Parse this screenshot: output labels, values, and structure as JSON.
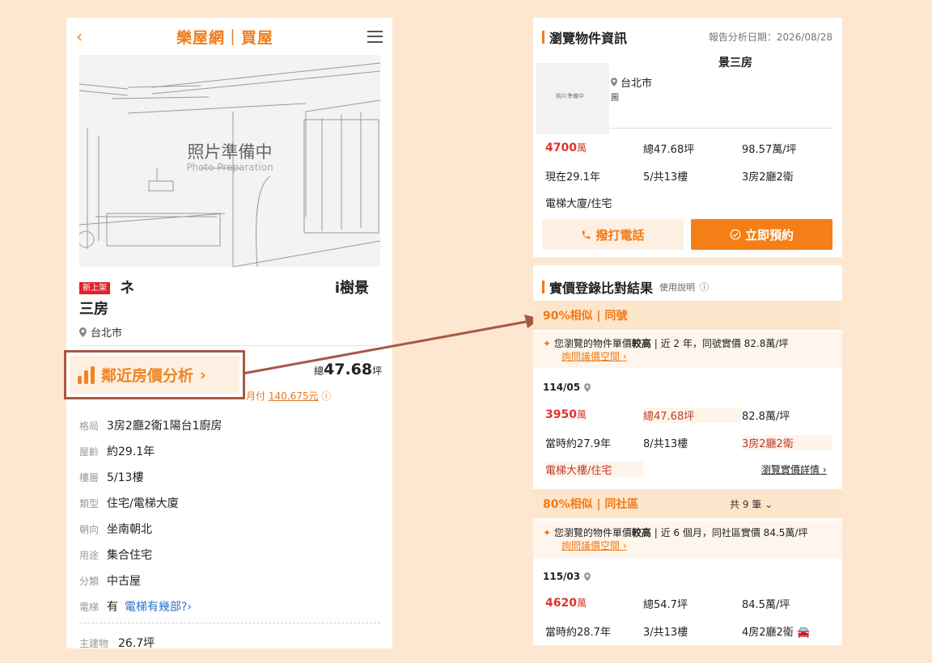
{
  "left": {
    "header": {
      "back": "‹",
      "title": "樂屋網｜買屋"
    },
    "photo": {
      "main_text": "照片準備中",
      "sub_text": "Photo Preparation"
    },
    "listing": {
      "badge": "新上架",
      "title_part1": "ネ",
      "title_part2": "i樹景",
      "title_part3": "三房",
      "location": "台北市",
      "total_prefix": "總",
      "total_area": "47.68",
      "total_unit": "坪",
      "monthly_prefix": "月付",
      "monthly_amount": "140,675元"
    },
    "specs": [
      {
        "key": "格局",
        "value": "3房2廳2衛1陽台1廚房"
      },
      {
        "key": "屋齡",
        "value": "約29.1年"
      },
      {
        "key": "樓層",
        "value": "5/13樓"
      },
      {
        "key": "類型",
        "value": "住宅/電梯大廈"
      },
      {
        "key": "朝向",
        "value": "坐南朝北"
      },
      {
        "key": "用途",
        "value": "集合住宅"
      },
      {
        "key": "分類",
        "value": "中古屋"
      },
      {
        "key": "電梯",
        "value": "有",
        "link": "電梯有幾部?›"
      }
    ],
    "main_building": {
      "key": "主建物",
      "value": "26.7坪"
    },
    "highlight_button": {
      "label": "鄰近房價分析",
      "chevron": "›"
    }
  },
  "right_top": {
    "section_title": "瀏覽物件資訊",
    "report_date": "報告分析日期：2026/08/28",
    "name": "景三房",
    "location": "台北市",
    "thumb_text": "照片準備中",
    "map_icon_label": "圖",
    "price": "4700",
    "price_unit": "萬",
    "area": "總47.68坪",
    "unit_price": "98.57萬/坪",
    "age": "現在29.1年",
    "floor": "5/共13樓",
    "layout": "3房2廳2衛",
    "type": "電梯大廈/住宅",
    "call_button": "撥打電話",
    "book_button": "立即預約"
  },
  "right_bottom": {
    "section_title": "實價登錄比對結果",
    "help": "使用說明",
    "group1": {
      "label": "90%相似 | 同號",
      "note_pre": "您瀏覽的物件單價",
      "note_bold": "較高",
      "note_post": "| 近 2 年，同號實價 82.8萬/坪",
      "note_link": "詢問議價空間 ›",
      "date": "114/05",
      "price": "3950",
      "price_unit": "萬",
      "area": "總47.68坪",
      "unit_price": "82.8萬/坪",
      "age": "當時約27.9年",
      "floor": "8/共13樓",
      "layout": "3房2廳2衛",
      "type": "電梯大樓/住宅",
      "detail_link": "瀏覽實價詳情 ›"
    },
    "group2": {
      "label": "80%相似 | 同社區",
      "count": "共 9 筆 ⌄",
      "note_pre": "您瀏覽的物件單價",
      "note_bold": "較高",
      "note_post": "| 近 6 個月，同社區實價 84.5萬/坪",
      "note_link": "詢問議價空間 ›",
      "date": "115/03",
      "price": "4620",
      "price_unit": "萬",
      "area": "總54.7坪",
      "unit_price": "84.5萬/坪",
      "age": "當時約28.7年",
      "floor": "3/共13樓",
      "layout": "4房2廳2衛"
    }
  },
  "colors": {
    "accent": "#f07a18",
    "highlight_border": "#a75843",
    "price_red": "#e0332b",
    "link_blue": "#2b70c9",
    "background": "#fde7d1"
  },
  "icons": [
    "back-chevron-icon",
    "menu-icon",
    "location-pin-icon",
    "info-icon",
    "phone-icon",
    "check-circle-icon",
    "bar-chart-icon",
    "sparkle-icon",
    "car-icon"
  ]
}
